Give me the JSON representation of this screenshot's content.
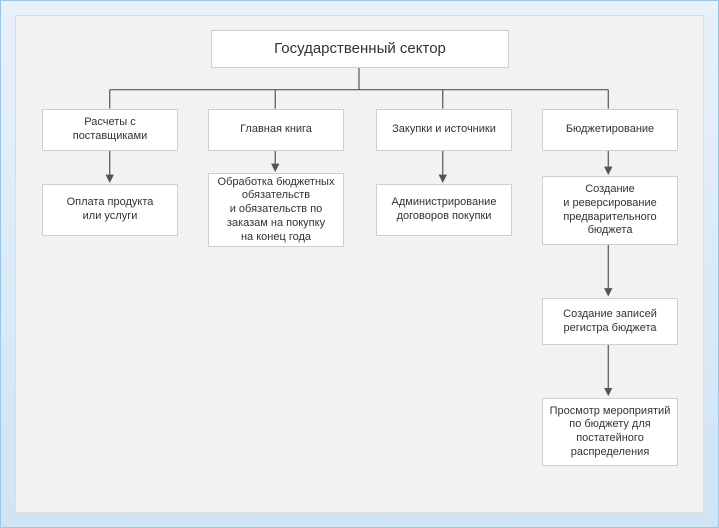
{
  "diagram": {
    "root": {
      "label": "Государственный сектор"
    },
    "branches": [
      {
        "label": "Расчеты с поставщиками",
        "children": [
          {
            "label": "Оплата продукта или услуги"
          }
        ]
      },
      {
        "label": "Главная книга",
        "children": [
          {
            "label": "Обработка бюджетных обязательств и обязательств по заказам на покупку на конец года"
          }
        ]
      },
      {
        "label": "Закупки и источники",
        "children": [
          {
            "label": "Администрирование договоров покупки"
          }
        ]
      },
      {
        "label": "Бюджетирование",
        "children": [
          {
            "label": "Создание и реверсирование предварительного бюджета"
          },
          {
            "label": "Создание записей регистра бюджета"
          },
          {
            "label": "Просмотр мероприятий по бюджету для постатейного распределения"
          }
        ]
      }
    ]
  }
}
